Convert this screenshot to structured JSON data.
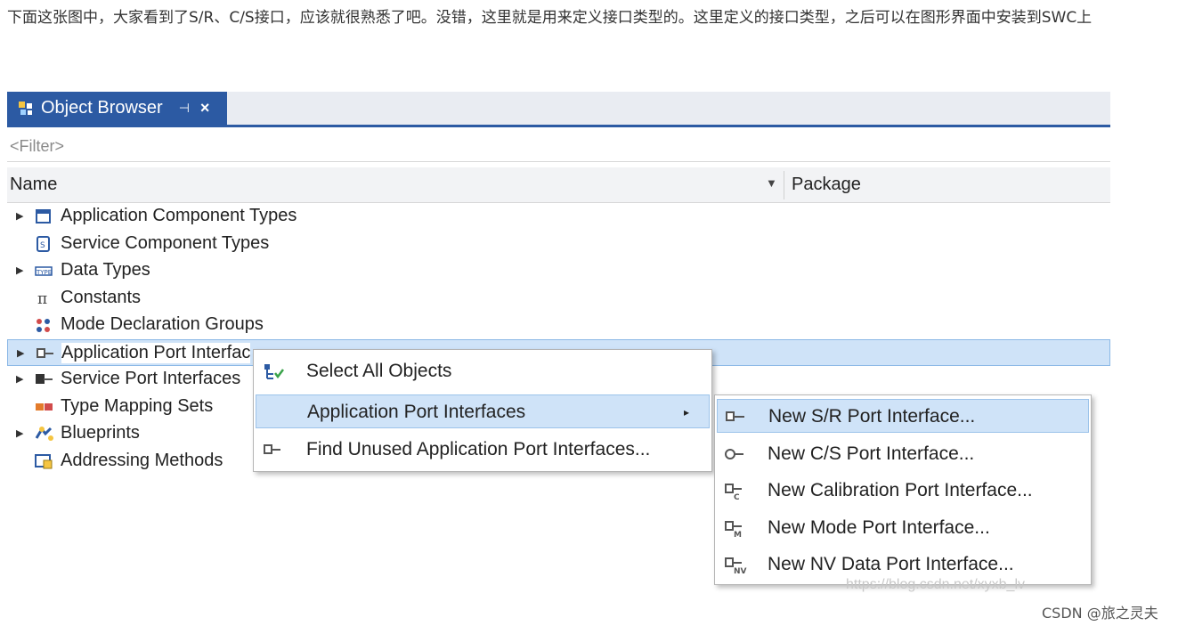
{
  "intro_text": "下面这张图中，大家看到了S/R、C/S接口，应该就很熟悉了吧。没错，这里就是用来定义接口类型的。这里定义的接口类型，之后可以在图形界面中安装到SWC上",
  "window": {
    "tab_title": "Object Browser",
    "pin_glyph": "⊣",
    "close_glyph": "×",
    "filter_placeholder": "<Filter>",
    "columns": {
      "name": "Name",
      "package": "Package"
    }
  },
  "tree": {
    "items": [
      {
        "label": "Application Component Types",
        "icon": "component-type-icon",
        "expandable": true
      },
      {
        "label": "Service Component Types",
        "icon": "service-component-icon",
        "expandable": false
      },
      {
        "label": "Data Types",
        "icon": "data-type-icon",
        "expandable": true
      },
      {
        "label": "Constants",
        "icon": "pi-icon",
        "expandable": false
      },
      {
        "label": "Mode Declaration Groups",
        "icon": "mode-group-icon",
        "expandable": false
      },
      {
        "label": "Application Port Interfac",
        "icon": "port-interface-icon",
        "expandable": true,
        "selected": true
      },
      {
        "label": "Service Port Interfaces",
        "icon": "service-port-icon",
        "expandable": true
      },
      {
        "label": "Type Mapping Sets",
        "icon": "type-mapping-icon",
        "expandable": false
      },
      {
        "label": "Blueprints",
        "icon": "blueprint-icon",
        "expandable": true
      },
      {
        "label": "Addressing Methods",
        "icon": "addressing-icon",
        "expandable": false
      }
    ]
  },
  "context_menu": {
    "items": [
      {
        "label": "Select All Objects",
        "icon": "select-all-icon"
      },
      {
        "label": "Application Port Interfaces",
        "icon": "",
        "highlighted": true,
        "submenu_arrow": "▸"
      },
      {
        "label": "Find Unused Application Port Interfaces...",
        "icon": "port-interface-icon"
      }
    ]
  },
  "submenu": {
    "items": [
      {
        "label": "New S/R Port Interface...",
        "icon": "sr-interface-icon",
        "sub": "",
        "highlighted": true
      },
      {
        "label": "New C/S Port Interface...",
        "icon": "cs-interface-icon",
        "sub": ""
      },
      {
        "label": "New Calibration Port Interface...",
        "icon": "calibration-interface-icon",
        "sub": "C"
      },
      {
        "label": "New Mode Port Interface...",
        "icon": "mode-interface-icon",
        "sub": "M"
      },
      {
        "label": "New NV Data Port Interface...",
        "icon": "nv-interface-icon",
        "sub": "NV"
      }
    ]
  },
  "watermark": "https://blog.csdn.net/xyxb_lv",
  "credit": "CSDN @旅之灵夫",
  "colors": {
    "tab_active": "#2c5aa3",
    "selection": "#cfe3f8",
    "menu_highlight": "#cfe3f8"
  }
}
